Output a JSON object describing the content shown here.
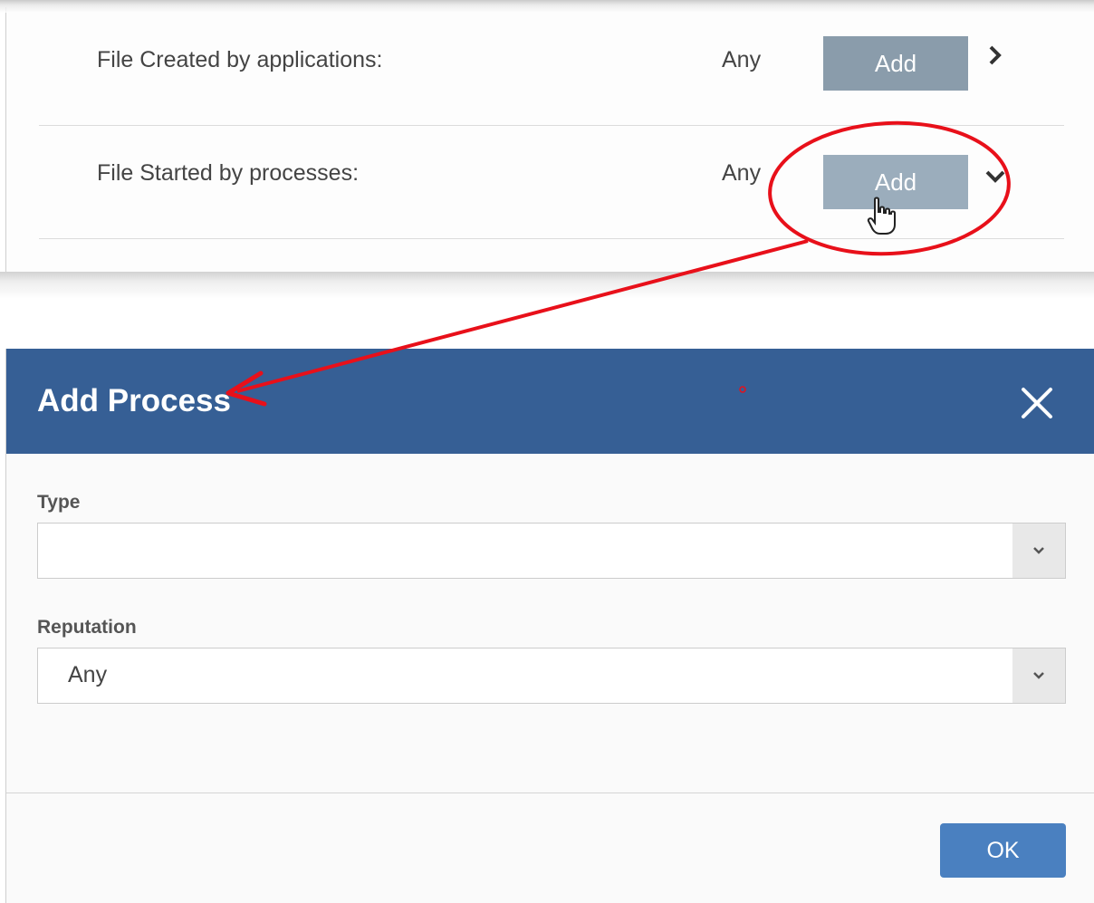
{
  "rules": {
    "rows": [
      {
        "label": "File Created by applications:",
        "value": "Any",
        "add_label": "Add",
        "chevron": "chevron-right-icon"
      },
      {
        "label": "File Started by processes:",
        "value": "Any",
        "add_label": "Add",
        "chevron": "chevron-down-icon"
      }
    ]
  },
  "dialog": {
    "title": "Add Process",
    "close_icon": "close-icon",
    "fields": [
      {
        "label": "Type",
        "value": ""
      },
      {
        "label": "Reputation",
        "value": "Any"
      }
    ],
    "ok_label": "OK"
  },
  "colors": {
    "header": "#365f95",
    "add_button": "#8a9cab",
    "ok_button": "#4a80c0",
    "annotation": "#e8101a"
  }
}
